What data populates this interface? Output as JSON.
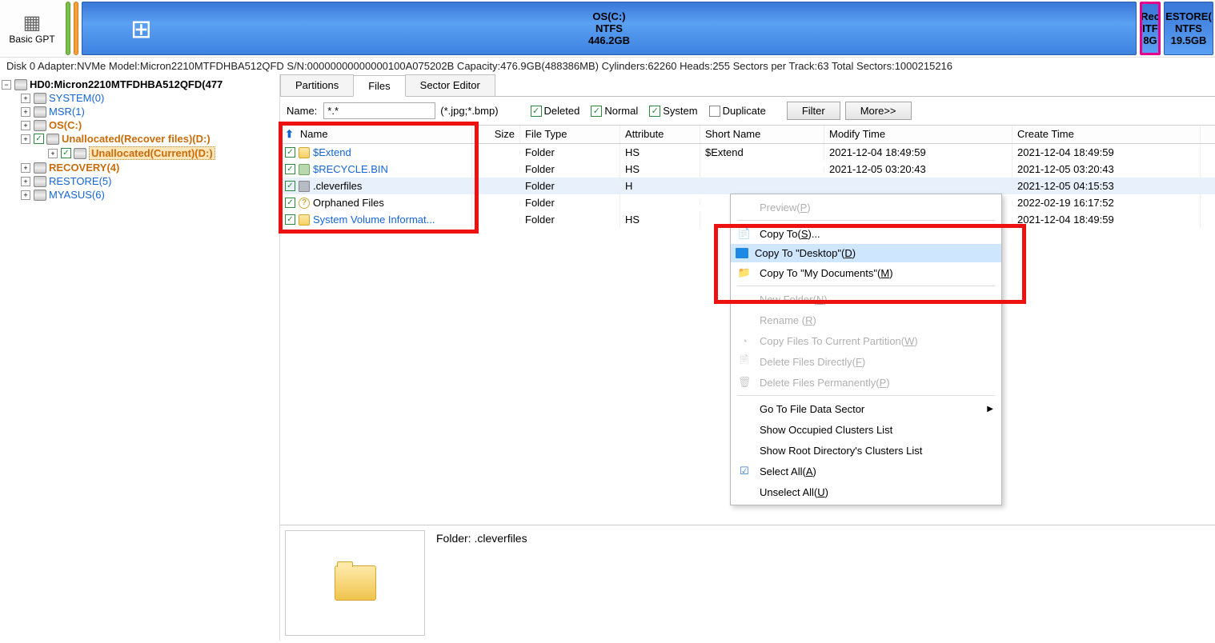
{
  "toolbar": {
    "basic_gpt": "Basic\nGPT"
  },
  "partition_map": {
    "main": {
      "title": "OS(C:)",
      "fs": "NTFS",
      "size": "446.2GB"
    },
    "small": {
      "l1": "Rec",
      "l2": "ITF",
      "l3": "8G"
    },
    "restore": {
      "l1": "ESTORE(",
      "l2": "NTFS",
      "l3": "19.5GB"
    }
  },
  "diskinfo": "Disk 0 Adapter:NVMe  Model:Micron2210MTFDHBA512QFD  S/N:00000000000000100A075202B  Capacity:476.9GB(488386MB)  Cylinders:62260  Heads:255  Sectors per Track:63  Total Sectors:1000215216",
  "tree": {
    "root": "HD0:Micron2210MTFDHBA512QFD(477",
    "items": [
      {
        "label": "SYSTEM(0)",
        "cls": "blue"
      },
      {
        "label": "MSR(1)",
        "cls": "blue"
      },
      {
        "label": "OS(C:)",
        "cls": "orange"
      },
      {
        "label": "Unallocated(Recover files)(D:)",
        "cls": "orange"
      },
      {
        "label": "Unallocated(Current)(D:)",
        "cls": "orange sel"
      },
      {
        "label": "RECOVERY(4)",
        "cls": "orange"
      },
      {
        "label": "RESTORE(5)",
        "cls": "blue"
      },
      {
        "label": "MYASUS(6)",
        "cls": "blue"
      }
    ]
  },
  "tabs": {
    "t1": "Partitions",
    "t2": "Files",
    "t3": "Sector Editor"
  },
  "filter": {
    "name_label": "Name:",
    "pattern": "*.*",
    "hint": "(*.jpg;*.bmp)",
    "deleted": "Deleted",
    "normal": "Normal",
    "system": "System",
    "duplicate": "Duplicate",
    "filter_btn": "Filter",
    "more_btn": "More>>"
  },
  "columns": {
    "name": "Name",
    "size": "Size",
    "type": "File Type",
    "attr": "Attribute",
    "short": "Short Name",
    "mtime": "Modify Time",
    "ctime": "Create Time"
  },
  "files": [
    {
      "name": "$Extend",
      "type": "Folder",
      "attr": "HS",
      "short": "$Extend",
      "mtime": "2021-12-04 18:49:59",
      "ctime": "2021-12-04 18:49:59",
      "icon": "fld",
      "link": true
    },
    {
      "name": "$RECYCLE.BIN",
      "type": "Folder",
      "attr": "HS",
      "short": "",
      "mtime": "2021-12-05 03:20:43",
      "ctime": "2021-12-05 03:20:43",
      "icon": "bin",
      "link": true
    },
    {
      "name": ".cleverfiles",
      "type": "Folder",
      "attr": "H",
      "short": "",
      "mtime": "",
      "ctime": "2021-12-05 04:15:53",
      "icon": "gray",
      "link": false,
      "sel": true
    },
    {
      "name": "Orphaned Files",
      "type": "Folder",
      "attr": "",
      "short": "",
      "mtime": "",
      "ctime": "2022-02-19 16:17:52",
      "icon": "qmark",
      "link": false
    },
    {
      "name": "System Volume Informat...",
      "type": "Folder",
      "attr": "HS",
      "short": "",
      "mtime": "",
      "ctime": "2021-12-04 18:49:59",
      "icon": "fld",
      "link": true
    }
  ],
  "ctx": {
    "preview": "Preview",
    "preview_k": "P",
    "copy_to": "Copy To",
    "copy_to_k": "S",
    "copy_to_tail": "...",
    "copy_desktop": "Copy To \"Desktop\"",
    "copy_desktop_k": "D",
    "copy_docs": "Copy To \"My Documents\"",
    "copy_docs_k": "M",
    "new_folder": "New Folder",
    "new_folder_k": "N",
    "rename": "Rename ",
    "rename_k": "R",
    "copy_part": "Copy Files To Current Partition",
    "copy_part_k": "W",
    "del_direct": "Delete Files Directly",
    "del_direct_k": "F",
    "del_perm": "Delete Files Permanently",
    "del_perm_k": "P",
    "goto_sector": "Go To File Data Sector",
    "show_clusters": "Show Occupied Clusters List",
    "show_root": "Show Root Directory's Clusters List",
    "select_all": "Select All",
    "select_all_k": "A",
    "unselect": "Unselect All",
    "unselect_k": "U"
  },
  "preview": {
    "label": "Folder: .cleverfiles"
  }
}
